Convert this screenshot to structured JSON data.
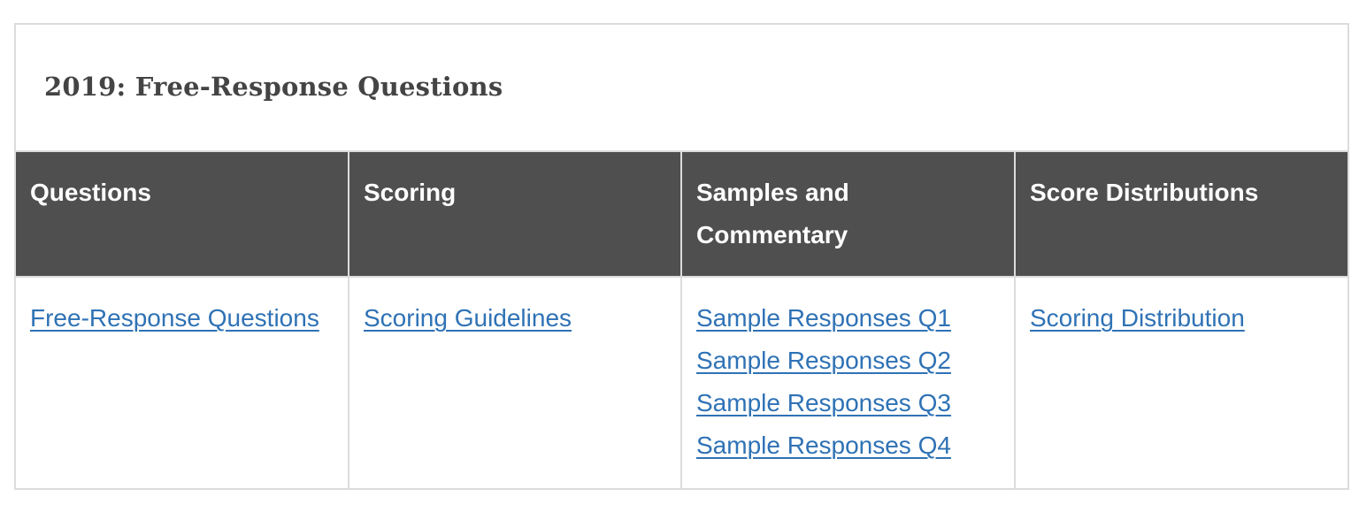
{
  "caption": "2019: Free-Response Questions",
  "colors": {
    "header_bg": "#4f4f4f",
    "header_text": "#ffffff",
    "link": "#2f72b5",
    "border": "#dcdcdc",
    "caption_text": "#444444"
  },
  "headers": [
    {
      "label": "Questions"
    },
    {
      "label": "Scoring"
    },
    {
      "label": "Samples and Commentary"
    },
    {
      "label": "Score Distributions"
    }
  ],
  "cells": {
    "questions": [
      {
        "label": "Free-Response Questions"
      }
    ],
    "scoring": [
      {
        "label": "Scoring Guidelines"
      }
    ],
    "samples": [
      {
        "label": "Sample Responses Q1"
      },
      {
        "label": "Sample Responses Q2"
      },
      {
        "label": "Sample Responses Q3"
      },
      {
        "label": "Sample Responses Q4"
      }
    ],
    "distributions": [
      {
        "label": "Scoring Distribution"
      }
    ]
  }
}
